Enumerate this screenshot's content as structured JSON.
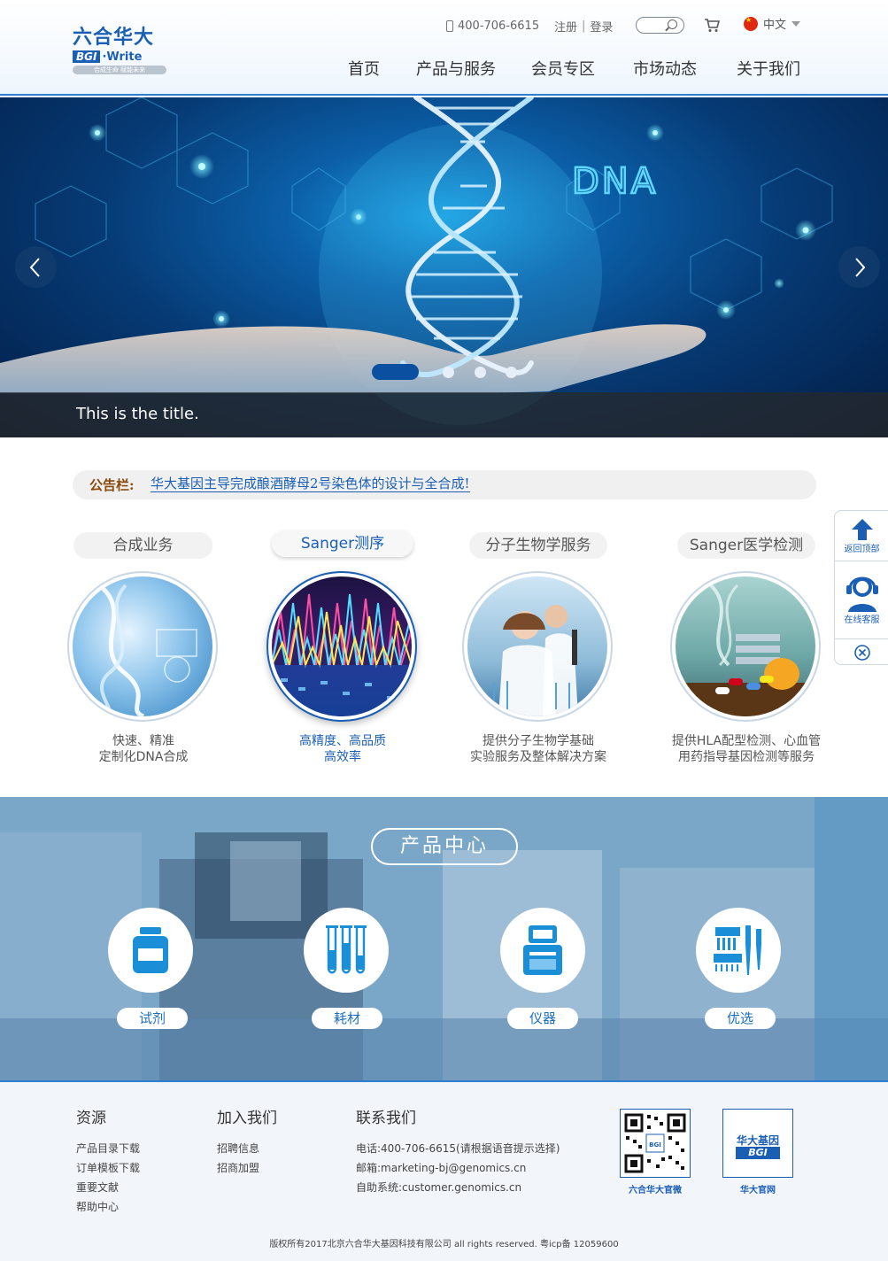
{
  "header": {
    "logo_cn": "六合华大",
    "logo_bgi": "BGI",
    "logo_write": "·Write",
    "logo_sub": "合成生命 赋能未来",
    "phone": "400-706-6615",
    "register": "注册",
    "login": "登录",
    "lang": "中文",
    "nav": [
      "首页",
      "产品与服务",
      "会员专区",
      "市场动态",
      "关于我们"
    ]
  },
  "banner": {
    "dna_text": "DNA",
    "caption": "This is the title.",
    "slides": 4,
    "active_slide": 1
  },
  "notice": {
    "label": "公告栏:",
    "text": "华大基因主导完成酿酒酵母2号染色体的设计与全合成!"
  },
  "services": [
    {
      "tab": "合成业务",
      "line1": "快速、精准",
      "line2": "定制化DNA合成",
      "active": false
    },
    {
      "tab": "Sanger测序",
      "line1": "高精度、高品质",
      "line2": "高效率",
      "active": true
    },
    {
      "tab": "分子生物学服务",
      "line1": "提供分子生物学基础",
      "line2": "实验服务及整体解决方案",
      "active": false
    },
    {
      "tab": "Sanger医学检测",
      "line1": "提供HLA配型检测、心血管",
      "line2": "用药指导基因检测等服务",
      "active": false
    }
  ],
  "side": {
    "top_label": "返回顶部",
    "service_label": "在线客服"
  },
  "products": {
    "title": "产品中心",
    "items": [
      {
        "label": "试剂",
        "icon": "reagent-bottle-icon"
      },
      {
        "label": "耗材",
        "icon": "test-tubes-icon"
      },
      {
        "label": "仪器",
        "icon": "instrument-icon"
      },
      {
        "label": "优选",
        "icon": "pipette-icon"
      }
    ]
  },
  "footer": {
    "col1_title": "资源",
    "col1": [
      "产品目录下载",
      "订单模板下载",
      "重要文献",
      "帮助中心"
    ],
    "col2_title": "加入我们",
    "col2": [
      "招聘信息",
      "招商加盟"
    ],
    "col3_title": "联系我们",
    "col3": [
      "电话:400-706-6615(请根据语音提示选择)",
      "邮箱:marketing-bj@genomics.cn",
      "自助系统:customer.genomics.cn"
    ],
    "qr1_caption": "六合华大官微",
    "qr2_caption": "华大官网",
    "qr2_logo_cn": "华大基因",
    "qr2_logo_en": "BGI",
    "copyright": "版权所有2017北京六合华大基因科技有限公司 all rights reserved. 粤icp备 12059600"
  },
  "colors": {
    "brand_blue": "#1a5fb4",
    "notice_label": "#8a4a0c"
  }
}
